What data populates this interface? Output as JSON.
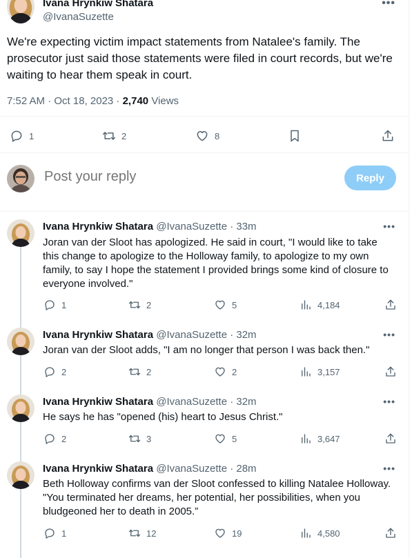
{
  "main_tweet": {
    "author_name": "Ivana Hrynkiw Shatara",
    "author_handle": "@IvanaSuzette",
    "more_glyph": "•••",
    "text": "We're expecting victim impact statements from Natalee's family. The prosecutor just said those statements were filed in court records, but we're waiting to hear them speak in court.",
    "time": "7:52 AM · Oct 18, 2023 · ",
    "views_count": "2,740",
    "views_label": "Views",
    "replies": "1",
    "reposts": "2",
    "likes": "8"
  },
  "composer": {
    "placeholder": "Post your reply",
    "reply_button": "Reply"
  },
  "replies": [
    {
      "name": "Ivana Hrynkiw Shatara",
      "handle": "@IvanaSuzette · 33m",
      "more": "•••",
      "text": "Joran van der Sloot has apologized. He said in court, \"I would like to take this change to apologize to the Holloway family, to apologize to my own family, to say I hope the statement I provided brings some kind of closure to everyone involved.\"",
      "replies": "1",
      "reposts": "2",
      "likes": "5",
      "views": "4,184"
    },
    {
      "name": "Ivana Hrynkiw Shatara",
      "handle": "@IvanaSuzette · 32m",
      "more": "•••",
      "text": "Joran van der Sloot adds, \"I am no longer that person I was back then.\"",
      "replies": "2",
      "reposts": "2",
      "likes": "2",
      "views": "3,157"
    },
    {
      "name": "Ivana Hrynkiw Shatara",
      "handle": "@IvanaSuzette · 32m",
      "more": "•••",
      "text": "He says he has \"opened (his) heart to Jesus Christ.\"",
      "replies": "2",
      "reposts": "3",
      "likes": "5",
      "views": "3,647"
    },
    {
      "name": "Ivana Hrynkiw Shatara",
      "handle": "@IvanaSuzette · 28m",
      "more": "•••",
      "text": "Beth Holloway confirms van der Sloot confessed to killing Natalee Holloway. \"You terminated her dreams, her potential, her possibilities, when you bludgeoned her to death in 2005.”",
      "replies": "1",
      "reposts": "12",
      "likes": "19",
      "views": "4,580"
    }
  ],
  "icons": {
    "reply": "reply-icon",
    "repost": "repost-icon",
    "like": "heart-icon",
    "bookmark": "bookmark-icon",
    "share": "share-icon",
    "views": "views-icon",
    "more": "more-icon"
  },
  "colors": {
    "text": "#0f1419",
    "secondary": "#536471",
    "reply_button_bg": "#8ecdf7",
    "divider": "#eff3f4",
    "thread_line": "#cfd9de"
  }
}
